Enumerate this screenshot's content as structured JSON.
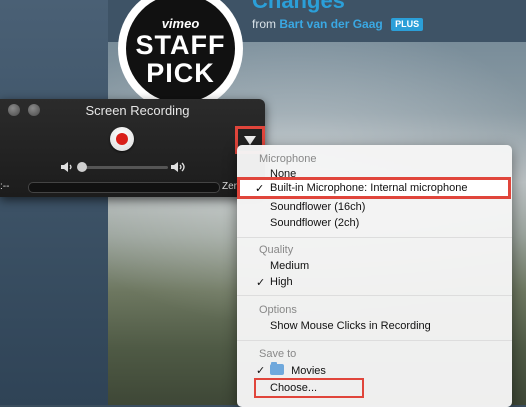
{
  "background": {
    "headline": "Changes",
    "from_prefix": "from",
    "author": "Bart van der Gaag",
    "plus_badge": "PLUS",
    "staff_pick": {
      "vimeo": "vimeo",
      "staff": "STAFF",
      "pick": "PICK"
    }
  },
  "recording_window": {
    "title": "Screen Recording",
    "time_left": ":--",
    "time_right": "Zer"
  },
  "menu": {
    "microphone": {
      "header": "Microphone",
      "items": [
        {
          "label": "None"
        },
        {
          "label": "Built-in Microphone: Internal microphone",
          "checked": true
        },
        {
          "label": "Soundflower (16ch)"
        },
        {
          "label": "Soundflower (2ch)"
        }
      ]
    },
    "quality": {
      "header": "Quality",
      "items": [
        {
          "label": "Medium"
        },
        {
          "label": "High",
          "checked": true
        }
      ]
    },
    "options": {
      "header": "Options",
      "items": [
        {
          "label": "Show Mouse Clicks in Recording"
        }
      ]
    },
    "save_to": {
      "header": "Save to",
      "items": [
        {
          "label": "Movies",
          "checked": true,
          "icon": "folder-icon"
        },
        {
          "label": "Choose..."
        }
      ]
    },
    "check_glyph": "✓"
  },
  "colors": {
    "highlight_border": "#e0453b",
    "record_dot": "#d91e18",
    "link_blue": "#2b9fd8"
  }
}
